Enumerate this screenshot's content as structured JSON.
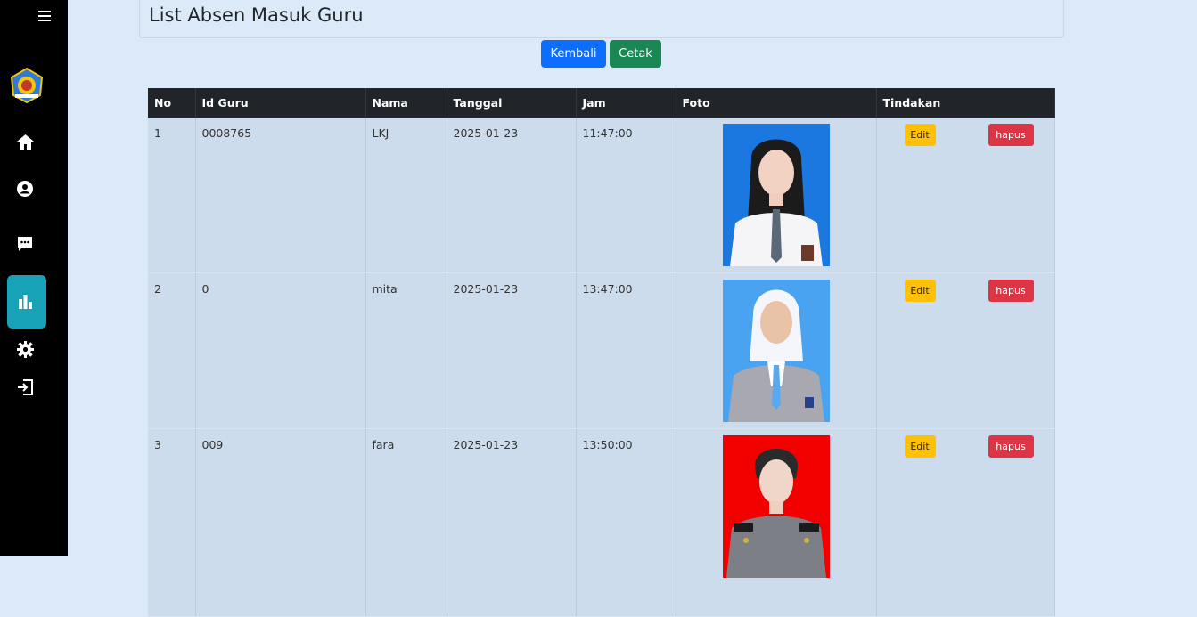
{
  "page": {
    "title": "List Absen Masuk Guru"
  },
  "buttons": {
    "back": "Kembali",
    "print": "Cetak"
  },
  "table": {
    "headers": [
      "No",
      "Id Guru",
      "Nama",
      "Tanggal",
      "Jam",
      "Foto",
      "Tindakan"
    ],
    "rows": [
      {
        "no": "1",
        "id": "0008765",
        "nama": "LKJ",
        "tanggal": "2025-01-23",
        "jam": "11:47:00",
        "photo_bg": "#1a78e0"
      },
      {
        "no": "2",
        "id": "0",
        "nama": "mita",
        "tanggal": "2025-01-23",
        "jam": "13:47:00",
        "photo_bg": "#4aa3f0"
      },
      {
        "no": "3",
        "id": "009",
        "nama": "fara",
        "tanggal": "2025-01-23",
        "jam": "13:50:00",
        "photo_bg": "#f20000"
      }
    ],
    "edit_label": "Edit",
    "delete_label": "hapus"
  },
  "sidebar": {
    "icons": [
      "menu-icon",
      "school-logo",
      "home-icon",
      "user-icon",
      "chat-icon",
      "chart-icon",
      "gear-icon",
      "logout-icon"
    ],
    "active": "chart-icon"
  }
}
